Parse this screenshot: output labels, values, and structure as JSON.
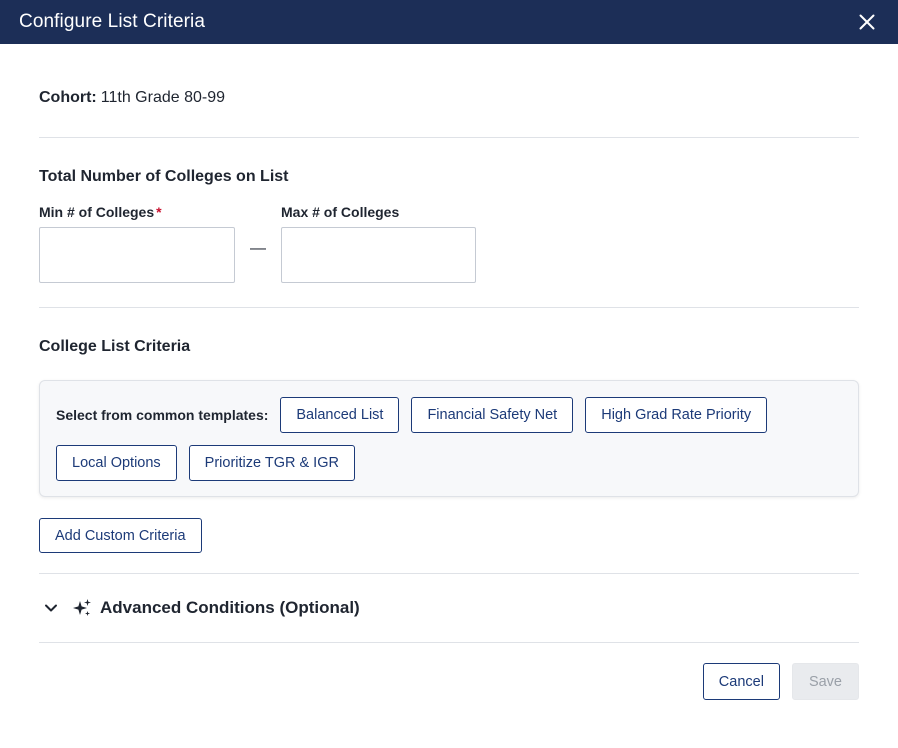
{
  "header": {
    "title": "Configure List Criteria",
    "close_icon": "close-icon"
  },
  "cohort": {
    "label": "Cohort:",
    "value": "11th Grade 80-99"
  },
  "range": {
    "title": "Total Number of Colleges on List",
    "min_label": "Min # of Colleges",
    "required_marker": "*",
    "min_value": "",
    "max_label": "Max # of Colleges",
    "max_value": "",
    "separator": "—"
  },
  "criteria": {
    "title": "College List Criteria",
    "templates_label": "Select from common templates:",
    "templates": [
      "Balanced List",
      "Financial Safety Net",
      "High Grad Rate Priority",
      "Local Options",
      "Prioritize TGR & IGR"
    ],
    "add_custom_label": "Add Custom Criteria"
  },
  "advanced": {
    "label": "Advanced Conditions (Optional)",
    "chevron_icon": "chevron-down-icon",
    "sparkle_icon": "sparkle-icon"
  },
  "footer": {
    "cancel_label": "Cancel",
    "save_label": "Save"
  },
  "colors": {
    "header_bg": "#1c2e57",
    "accent": "#1c3a78",
    "required": "#c8102e",
    "disabled_bg": "#e9ebee"
  }
}
